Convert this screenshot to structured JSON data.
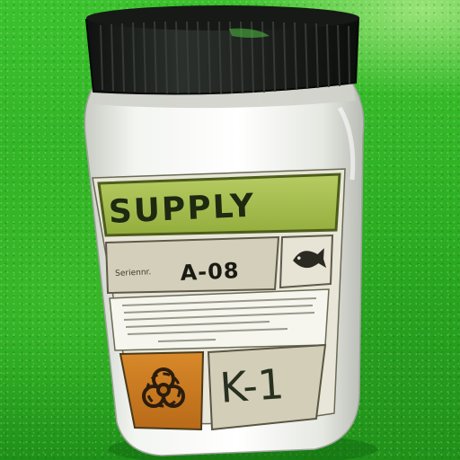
{
  "scene": {
    "background": "green grass floor",
    "colors": {
      "grass": "#2fb124",
      "lid": "#1c1f1c",
      "jar": "#f2f4f0",
      "label_green": "#a8c050",
      "label_tan": "#d9d6c4",
      "hazard_orange": "#c8781c"
    }
  },
  "label": {
    "title": "SUPPLY",
    "code_prefix": "Seriennr.",
    "code": "A-08",
    "unit": "K-1",
    "icons": {
      "hazard": "biohazard-icon",
      "fish": "fish-icon"
    }
  }
}
